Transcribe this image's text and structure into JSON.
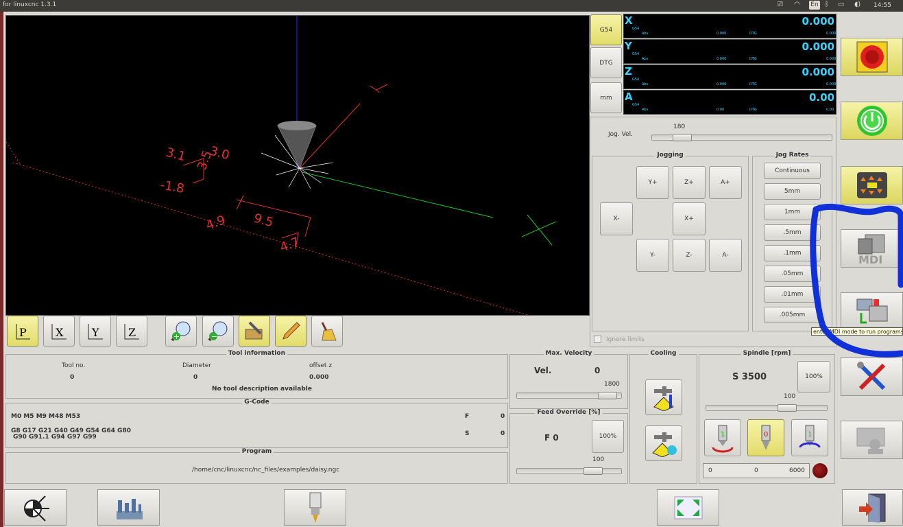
{
  "system_bar": {
    "window_title": "for linuxcnc   1.3.1",
    "keyboard_layout": "En",
    "clock": "14:55"
  },
  "dro_buttons": {
    "coord_system": "G54",
    "dtg": "DTG",
    "units": "mm"
  },
  "dro": [
    {
      "axis": "X",
      "sys": "G54",
      "value": "0.000",
      "abs_label": "Abs",
      "abs_value": "0.000",
      "dtg_label": "DTG",
      "dtg_value": "0.000"
    },
    {
      "axis": "Y",
      "sys": "G54",
      "value": "0.000",
      "abs_label": "Abs",
      "abs_value": "0.000",
      "dtg_label": "DTG",
      "dtg_value": "0.000"
    },
    {
      "axis": "Z",
      "sys": "G54",
      "value": "0.000",
      "abs_label": "Abs",
      "abs_value": "0.000",
      "dtg_label": "DTG",
      "dtg_value": "0.000"
    },
    {
      "axis": "A",
      "sys": "G54",
      "value": "0.00",
      "abs_label": "Abs",
      "abs_value": "0.00",
      "dtg_label": "DTG",
      "dtg_value": "0.00"
    }
  ],
  "jog": {
    "vel_label": "Jog. Vel.",
    "vel_value": "180",
    "vel_fraction": 0.13,
    "jogging_title": "Jogging",
    "buttons": {
      "y_plus": "Y+",
      "z_plus": "Z+",
      "a_plus": "A+",
      "x_minus": "X-",
      "x_plus": "X+",
      "y_minus": "Y-",
      "z_minus": "Z-",
      "a_minus": "A-"
    },
    "rates_title": "Jog Rates",
    "rates": [
      "Continuous",
      "5mm",
      "1mm",
      ".5mm",
      ".1mm",
      ".05mm",
      ".01mm",
      ".005mm"
    ],
    "ignore_limits": "Ignore limits"
  },
  "tooltip": "enter MDI mode to run programs",
  "tool_info": {
    "title": "Tool information",
    "tool_no_label": "Tool no.",
    "tool_no": "0",
    "diameter_label": "Diameter",
    "diameter": "0",
    "offset_label": "offset z",
    "offset": "0.000",
    "description": "No tool description available"
  },
  "gcode": {
    "title": "G-Code",
    "mcodes": "M0 M5 M9 M48 M53",
    "gcodes_1": "G8 G17 G21 G40 G49 G54 G64 G80",
    "gcodes_2": "G90 G91.1 G94 G97 G99",
    "f_label": "F",
    "f_value": "0",
    "s_label": "S",
    "s_value": "0"
  },
  "program": {
    "title": "Program",
    "path": "/home/cnc/linuxcnc/nc_files/examples/daisy.ngc"
  },
  "max_velocity": {
    "title": "Max. Velocity",
    "label": "Vel.",
    "value": "0",
    "slider_value": "1800",
    "slider_fraction": 0.95
  },
  "feed_override": {
    "title": "Feed Override [%]",
    "label": "F  0",
    "button": "100%",
    "slider_value": "100",
    "slider_fraction": 0.78
  },
  "cooling": {
    "title": "Cooling"
  },
  "spindle": {
    "title": "Spindle [rpm]",
    "speed": "S 3500",
    "button": "100%",
    "slider_value": "100",
    "slider_fraction": 0.7,
    "ccw_label": "1",
    "stop_label": "0",
    "cw_label": "1",
    "bar_values": [
      "0",
      "0",
      "6000"
    ]
  },
  "preview_annotations": {
    "dims": [
      "3.1",
      "3.0",
      "3.5",
      "-1.8",
      "4.9",
      "9.5",
      "4.7"
    ]
  }
}
